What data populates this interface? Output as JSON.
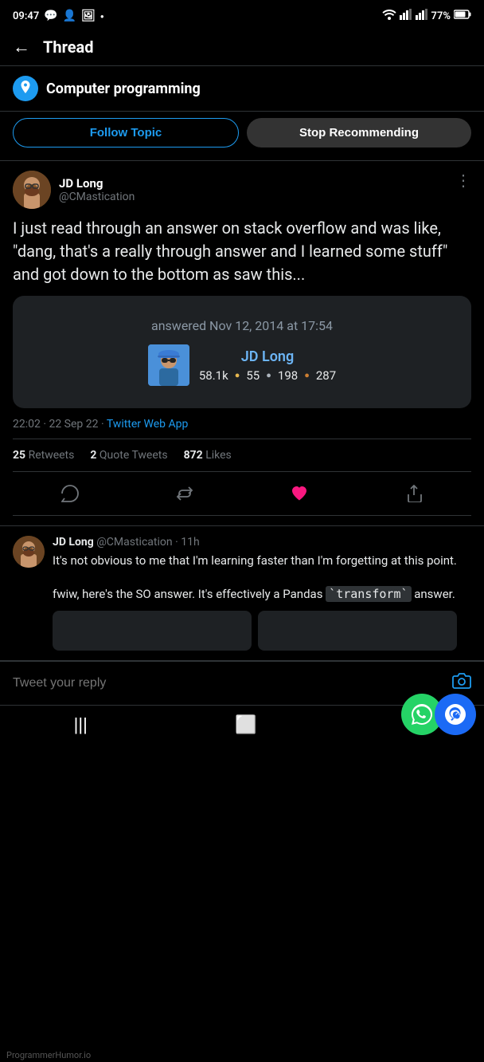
{
  "statusBar": {
    "time": "09:47",
    "battery": "77%",
    "signal": "wifi"
  },
  "nav": {
    "backLabel": "←",
    "title": "Thread"
  },
  "topic": {
    "name": "Computer programming",
    "iconEmoji": "📌"
  },
  "buttons": {
    "followTopic": "Follow Topic",
    "stopRecommending": "Stop Recommending"
  },
  "tweet": {
    "authorName": "JD Long",
    "authorHandle": "@CMastication",
    "text": "I just read through an answer on stack overflow and was like, \"dang, that's a really through answer and I learned some stuff\" and got down to the bottom as saw this...",
    "timestamp": "22:02 · 22 Sep 22",
    "source": "Twitter Web App",
    "retweets": "25",
    "retweetsLabel": "Retweets",
    "quoteLabel": "Quote Tweets",
    "quotes": "2",
    "likes": "872",
    "likesLabel": "Likes"
  },
  "embeddedCard": {
    "answeredText": "answered Nov 12, 2014 at 17:54",
    "soUsername": "JD Long",
    "soScore": "58.1k",
    "goldCount": "55",
    "silverCount": "198",
    "bronzeCount": "287"
  },
  "reply": {
    "authorName": "JD Long",
    "handle": "@CMastication",
    "time": "11h",
    "text1": "It's not obvious to me that I'm learning faster than I'm forgetting at this point.",
    "text2": "fwiw, here's the SO answer. It's effectively a Pandas `transform` answer."
  },
  "replyInput": {
    "placeholder": "Tweet your reply"
  },
  "watermark": "ProgrammerHumor.io"
}
